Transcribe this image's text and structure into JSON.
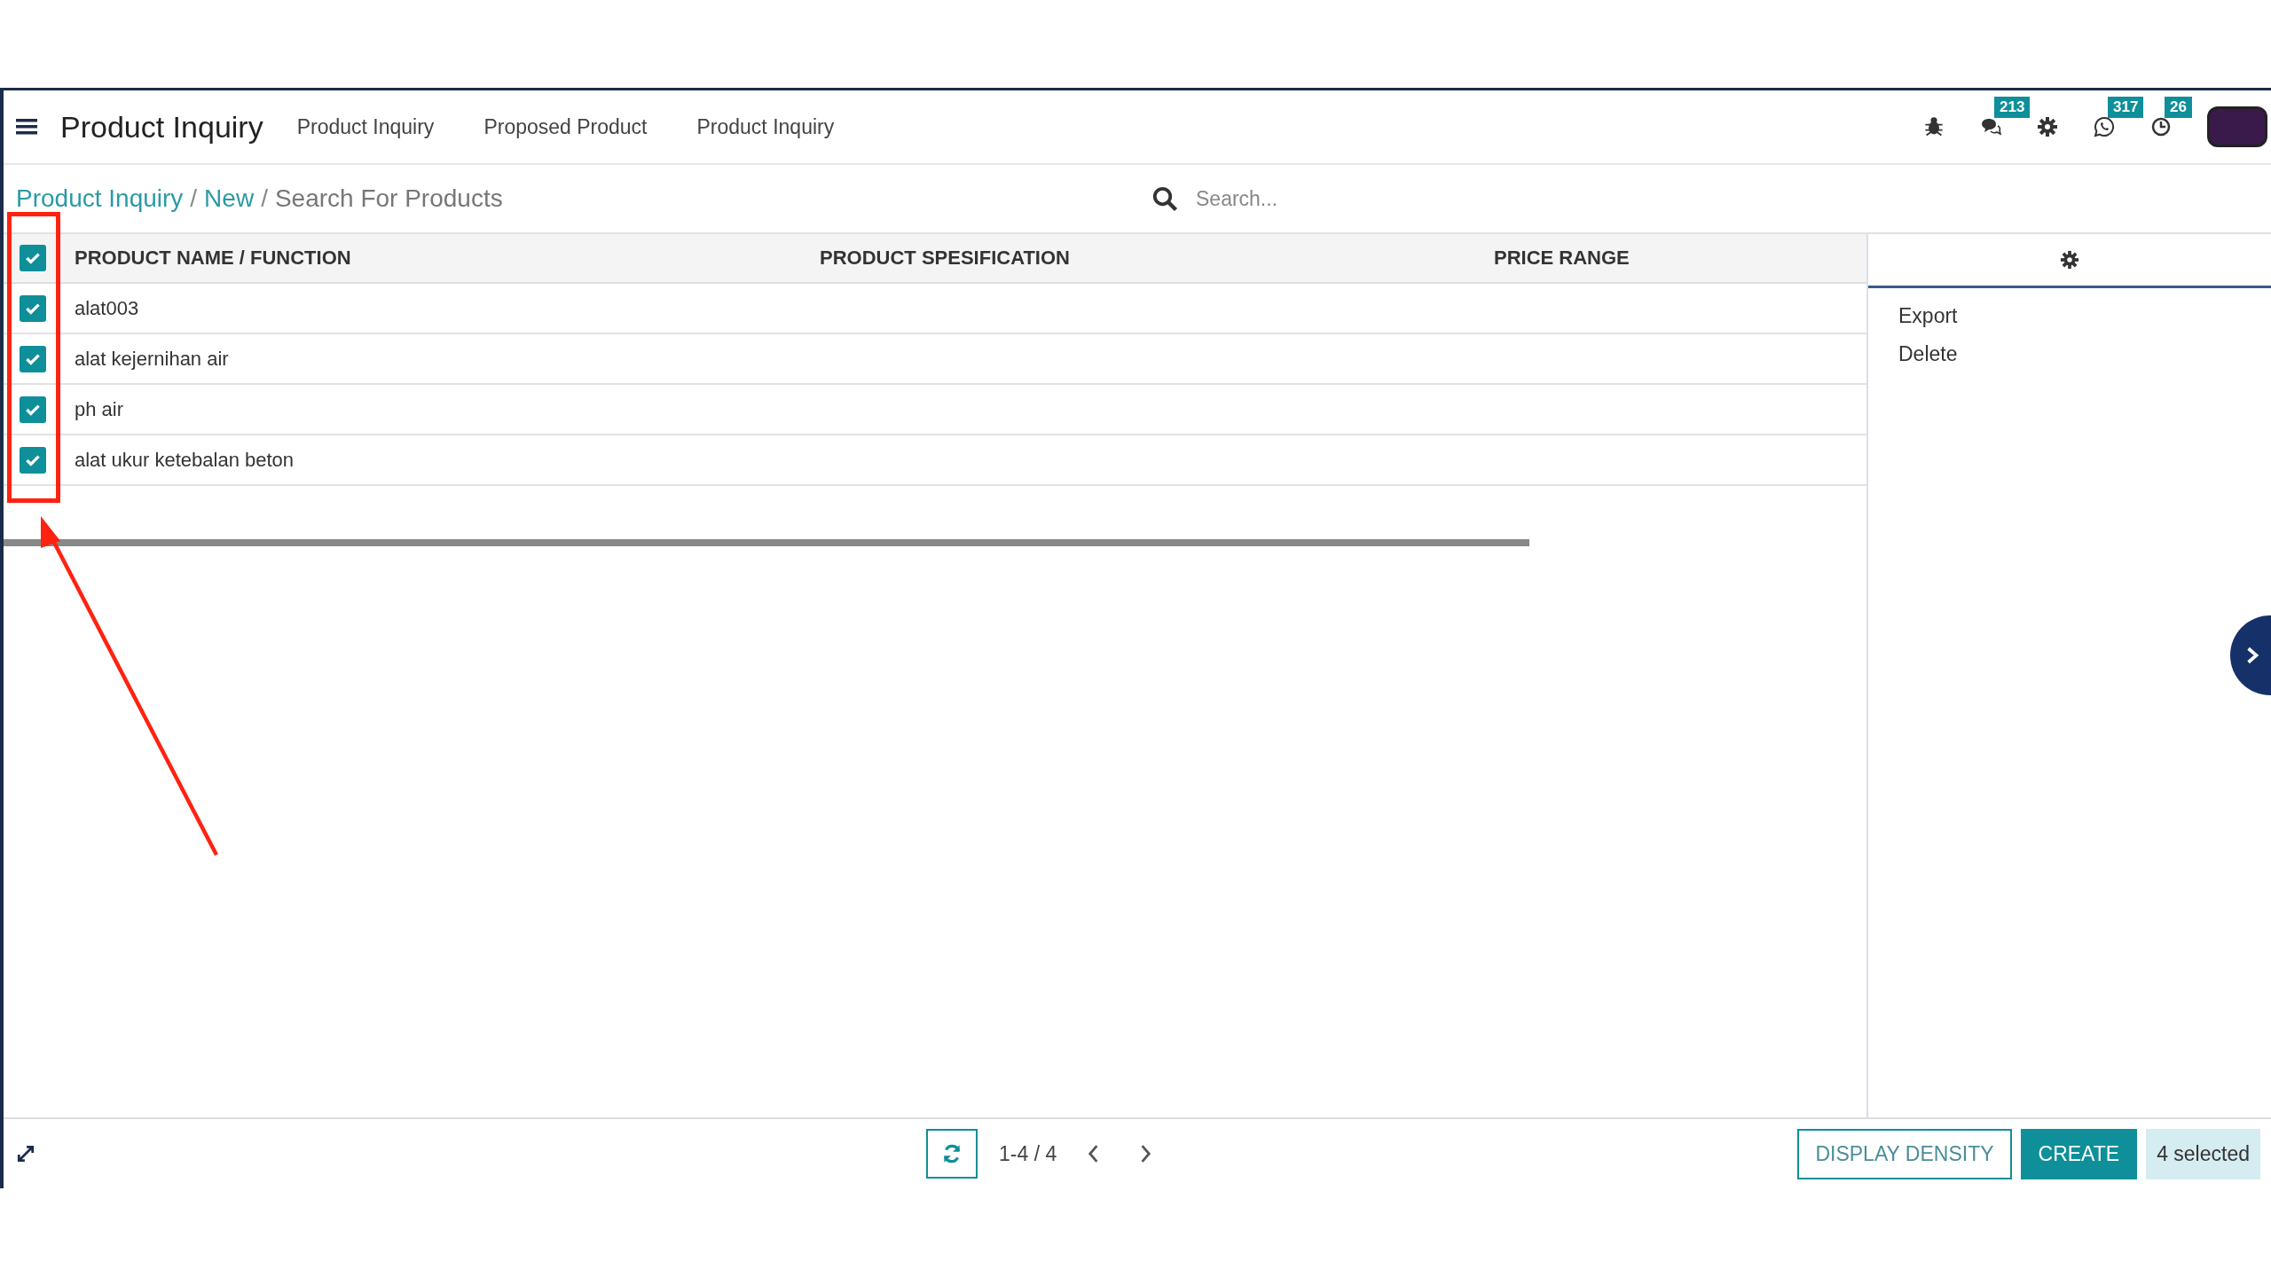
{
  "navbar": {
    "app_title": "Product Inquiry",
    "menu": [
      "Product Inquiry",
      "Proposed Product",
      "Product Inquiry"
    ],
    "systray": [
      {
        "kind": "bug"
      },
      {
        "kind": "chat",
        "badge": "213"
      },
      {
        "kind": "gear"
      },
      {
        "kind": "whatsapp",
        "badge": "317"
      },
      {
        "kind": "clock",
        "badge": "26"
      }
    ]
  },
  "breadcrumb": [
    {
      "kind": "link",
      "label": "Product Inquiry"
    },
    {
      "kind": "separator",
      "label": "/"
    },
    {
      "kind": "link",
      "label": "New"
    },
    {
      "kind": "separator",
      "label": "/"
    },
    {
      "kind": "current",
      "label": "Search For Products"
    }
  ],
  "search": {
    "placeholder": "Search..."
  },
  "table": {
    "header_checked": true,
    "columns": [
      "PRODUCT NAME / FUNCTION",
      "PRODUCT SPESIFICATION",
      "PRICE RANGE"
    ],
    "rows": [
      {
        "name": "alat003",
        "checked": true
      },
      {
        "name": "alat kejernihan air",
        "checked": true
      },
      {
        "name": "ph air",
        "checked": true
      },
      {
        "name": "alat ukur ketebalan beton",
        "checked": true
      }
    ]
  },
  "side_panel": {
    "actions": [
      "Export",
      "Delete"
    ]
  },
  "pager": {
    "range": "1-4 / 4"
  },
  "buttons": {
    "display_density": "DISPLAY DENSITY",
    "create": "CREATE",
    "selected_count": "4 selected"
  }
}
